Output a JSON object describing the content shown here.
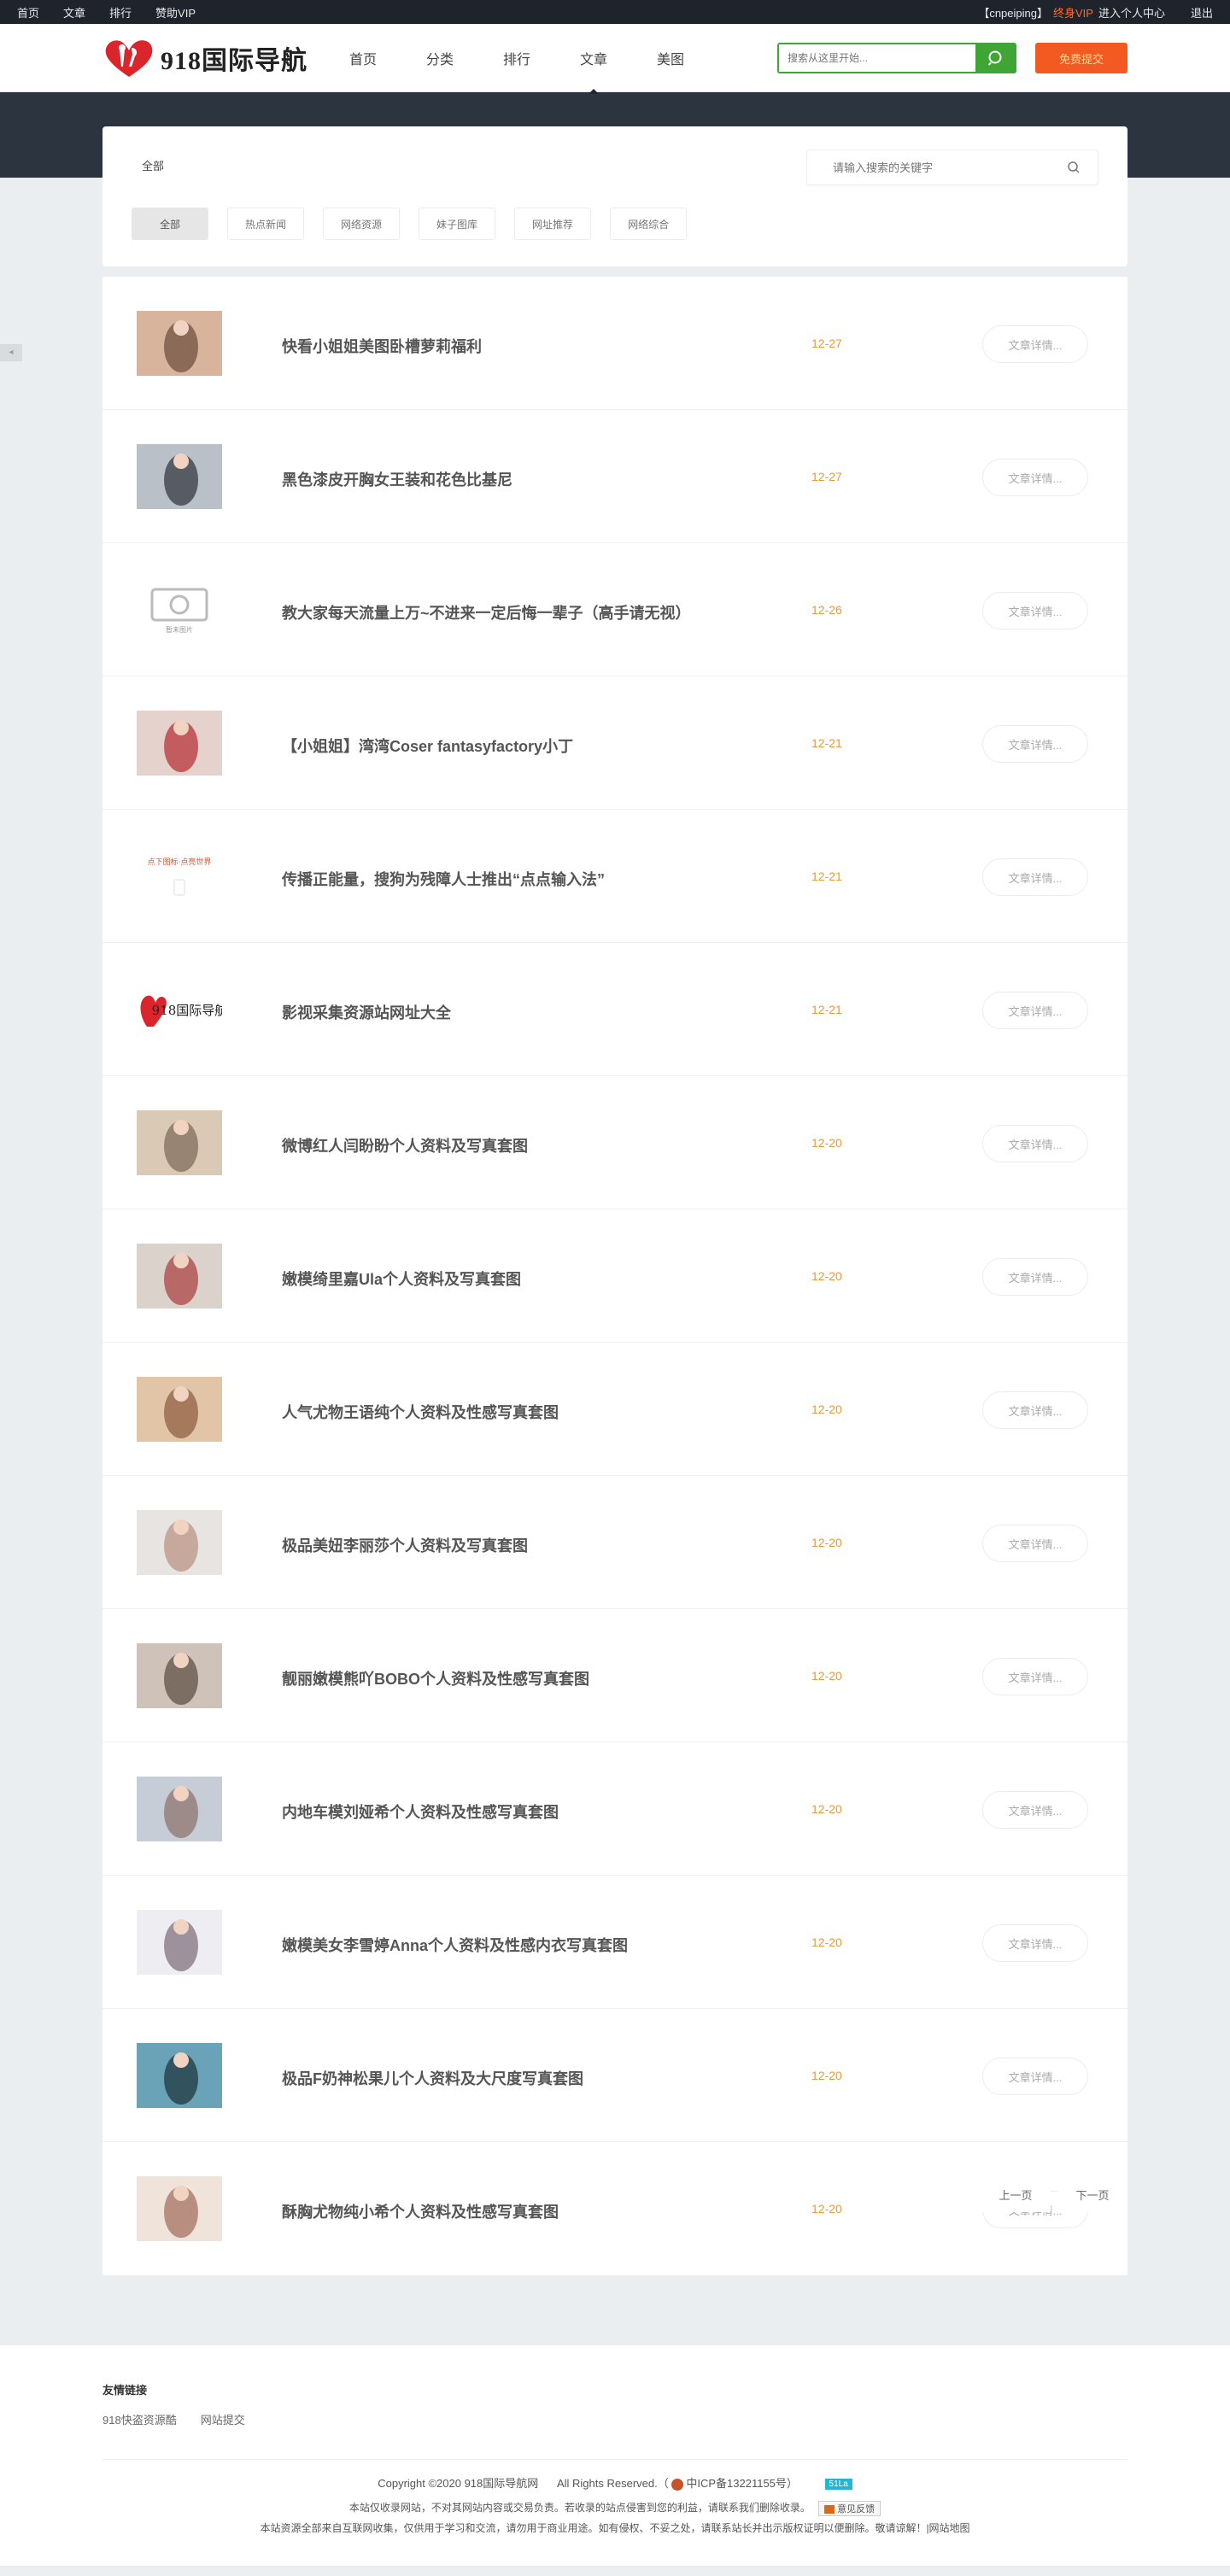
{
  "topbar": {
    "links": [
      "首页",
      "文章",
      "排行",
      "赞助VIP"
    ],
    "user": "【cnpeiping】",
    "vip": "终身VIP",
    "center": "进入个人中心",
    "logout": "退出"
  },
  "header": {
    "logo_text": "918国际导航",
    "nav": [
      "首页",
      "分类",
      "排行",
      "文章",
      "美图"
    ],
    "active_nav": "文章",
    "search_placeholder": "搜索从这里开始...",
    "submit_label": "免费提交"
  },
  "filter": {
    "title": "全部",
    "search_placeholder": "请输入搜索的关键字",
    "chips": [
      "全部",
      "热点新闻",
      "网络资源",
      "妹子图库",
      "网址推荐",
      "网络综合"
    ]
  },
  "detail_label": "文章详情...",
  "articles": [
    {
      "title": "快看小姐姐美图卧槽萝莉福利",
      "date": "12-27",
      "thumb": "photo"
    },
    {
      "title": "黑色漆皮开胸女王装和花色比基尼",
      "date": "12-27",
      "thumb": "photo"
    },
    {
      "title": "教大家每天流量上万~不进来一定后悔一辈子（高手请无视）",
      "date": "12-26",
      "thumb": "noimage"
    },
    {
      "title": "【小姐姐】湾湾Coser fantasyfactory小丁",
      "date": "12-21",
      "thumb": "photo"
    },
    {
      "title": "传播正能量，搜狗为残障人士推出“点点输入法”",
      "date": "12-21",
      "thumb": "ad"
    },
    {
      "title": "影视采集资源站网址大全",
      "date": "12-21",
      "thumb": "logo"
    },
    {
      "title": "微博红人闫盼盼个人资料及写真套图",
      "date": "12-20",
      "thumb": "photo"
    },
    {
      "title": "嫩模绮里嘉Ula个人资料及写真套图",
      "date": "12-20",
      "thumb": "photo"
    },
    {
      "title": "人气尤物王语纯个人资料及性感写真套图",
      "date": "12-20",
      "thumb": "photo"
    },
    {
      "title": "极品美妞李丽莎个人资料及写真套图",
      "date": "12-20",
      "thumb": "photo"
    },
    {
      "title": "靓丽嫩模熊吖BOBO个人资料及性感写真套图",
      "date": "12-20",
      "thumb": "photo"
    },
    {
      "title": "内地车模刘娅希个人资料及性感写真套图",
      "date": "12-20",
      "thumb": "photo"
    },
    {
      "title": "嫩模美女李雪婷Anna个人资料及性感内衣写真套图",
      "date": "12-20",
      "thumb": "photo"
    },
    {
      "title": "极品F奶神松果儿个人资料及大尺度写真套图",
      "date": "12-20",
      "thumb": "photo"
    },
    {
      "title": "酥胸尤物纯小希个人资料及性感写真套图",
      "date": "12-20",
      "thumb": "photo"
    }
  ],
  "thumb_texts": {
    "noimage": "暂未图片",
    "ad_line1": "点下图标·点亮世界",
    "logo_text": "918国际导航"
  },
  "pager": {
    "prev": "上一页",
    "next": "下一页"
  },
  "footer": {
    "links_title": "友情链接",
    "links": [
      "918快盗资源酷",
      "网站提交"
    ],
    "copyright": "Copyright ©2020 918国际导航网",
    "rights": "All Rights Reserved.（",
    "icp": "中ICP备13221155号）",
    "badge": "51La",
    "line1": "本站仅收录网站，不对其网站内容或交易负责。若收录的站点侵害到您的利益，请联系我们删除收录。",
    "feedback": "意见反馈",
    "line2": "本站资源全部来自互联网收集，仅供用于学习和交流，请勿用于商业用途。如有侵权、不妥之处，请联系站长并出示版权证明以便删除。敬请谅解！|网站地图"
  },
  "colors": {
    "accent_green": "#3fa535",
    "accent_orange": "#f25a22",
    "date": "#e59a3d",
    "topbar": "#1f232b",
    "banner": "#2c3440"
  }
}
